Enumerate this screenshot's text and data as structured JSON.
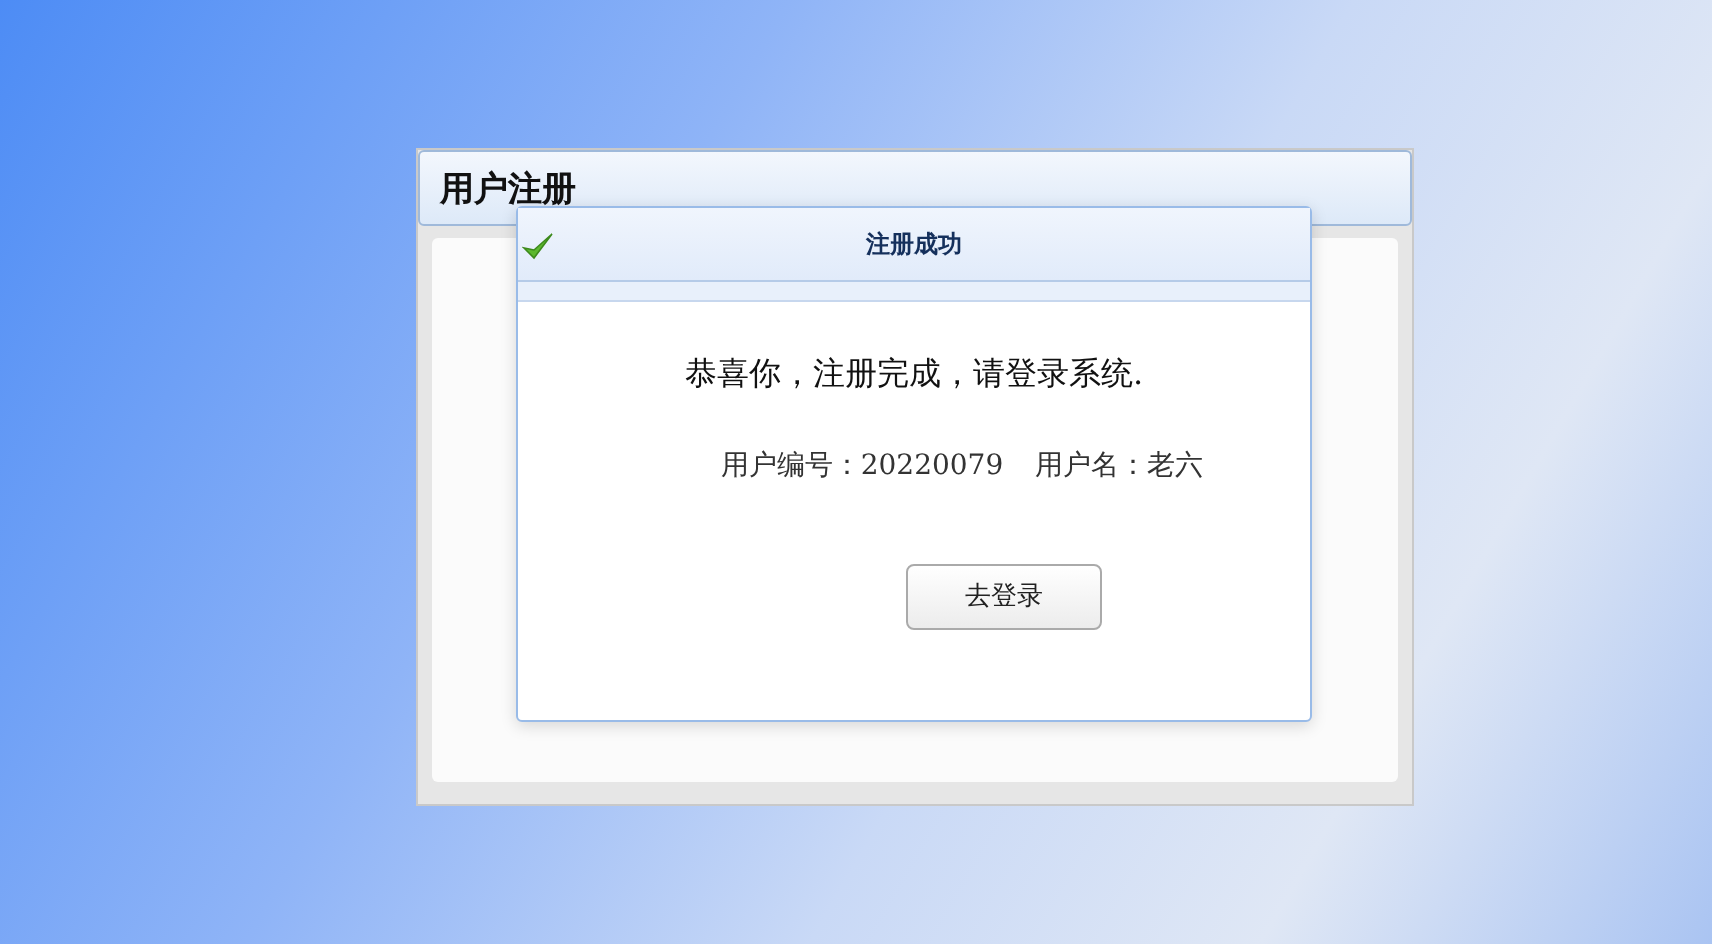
{
  "panel": {
    "title": "用户注册"
  },
  "dialog": {
    "title": "注册成功",
    "message": "恭喜你，注册完成，请登录系统.",
    "details": [
      {
        "label": "用户编号：",
        "value": "20220079"
      },
      {
        "label": "用户名：",
        "value": "老六"
      }
    ],
    "button": "去登录"
  }
}
